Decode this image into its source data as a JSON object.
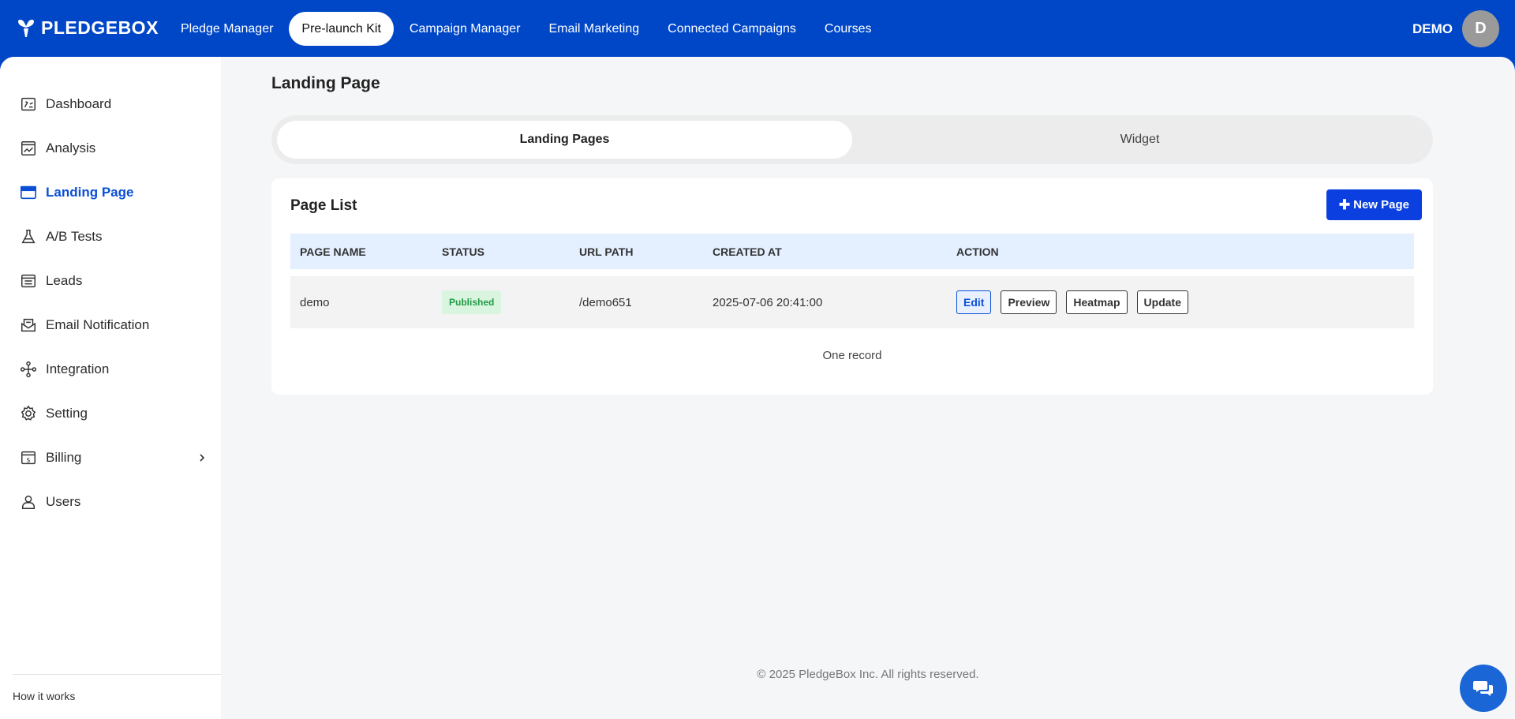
{
  "brand": {
    "name": "PLEDGEBOX",
    "accent": "#0047c8"
  },
  "topnav": {
    "items": [
      {
        "label": "Pledge Manager"
      },
      {
        "label": "Pre-launch Kit"
      },
      {
        "label": "Campaign Manager"
      },
      {
        "label": "Email Marketing"
      },
      {
        "label": "Connected Campaigns"
      },
      {
        "label": "Courses"
      }
    ],
    "active": "Pre-launch Kit"
  },
  "user": {
    "name": "DEMO",
    "initial": "D"
  },
  "sidebar": {
    "items": [
      {
        "label": "Dashboard",
        "icon": "dashboard-icon"
      },
      {
        "label": "Analysis",
        "icon": "analysis-icon"
      },
      {
        "label": "Landing Page",
        "icon": "landing-page-icon"
      },
      {
        "label": "A/B Tests",
        "icon": "flask-icon"
      },
      {
        "label": "Leads",
        "icon": "list-icon"
      },
      {
        "label": "Email Notification",
        "icon": "email-icon"
      },
      {
        "label": "Integration",
        "icon": "integration-icon"
      },
      {
        "label": "Setting",
        "icon": "gear-icon"
      },
      {
        "label": "Billing",
        "icon": "billing-icon"
      },
      {
        "label": "Users",
        "icon": "user-icon"
      }
    ],
    "active": "Landing Page",
    "footer_link": "How it works"
  },
  "main": {
    "title": "Landing Page",
    "tabs": [
      {
        "label": "Landing Pages"
      },
      {
        "label": "Widget"
      }
    ],
    "active_tab": "Landing Pages",
    "card": {
      "title": "Page List",
      "new_button": "New Page",
      "columns": [
        "PAGE NAME",
        "STATUS",
        "URL PATH",
        "CREATED AT",
        "ACTION"
      ],
      "rows": [
        {
          "name": "demo",
          "status": "Published",
          "url": "/demo651",
          "created": "2025-07-06 20:41:00",
          "actions": [
            "Edit",
            "Preview",
            "Heatmap",
            "Update"
          ]
        }
      ],
      "record_count": "One record"
    }
  },
  "footer": {
    "text": "© 2025 PledgeBox Inc. All rights reserved."
  }
}
